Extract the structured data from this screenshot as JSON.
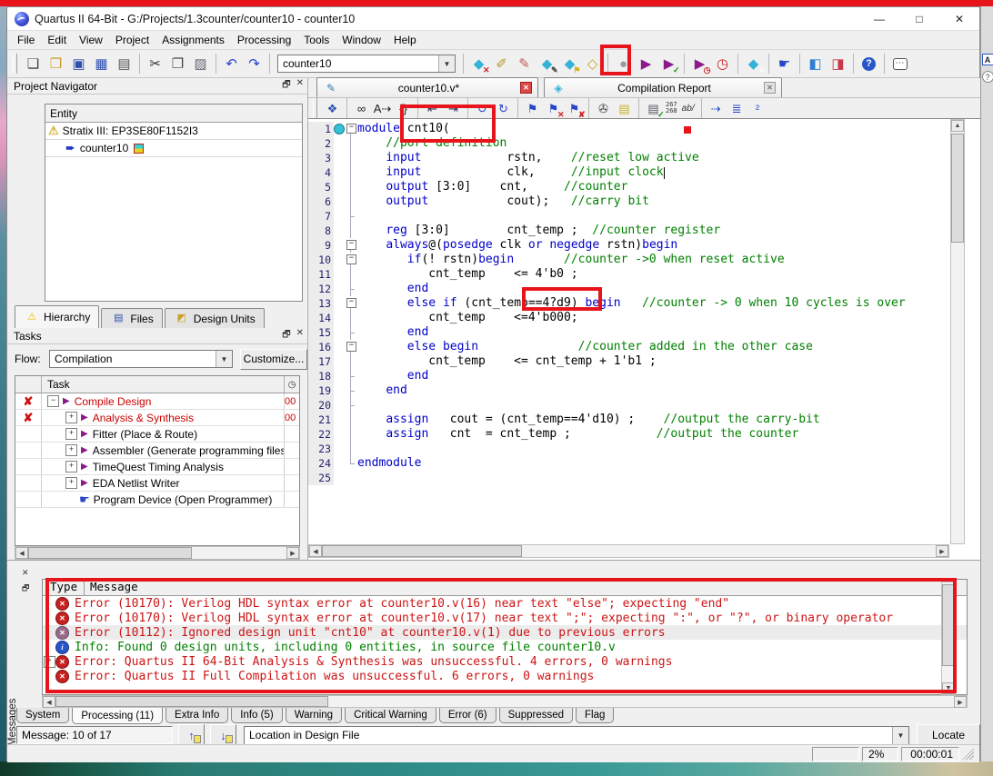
{
  "colors": {
    "annotation": "#e8141c",
    "keyword": "#0000c8",
    "comment": "#008000",
    "error_text": "#cc1414",
    "info_text": "#008000",
    "task_error": "#cc0000"
  },
  "window": {
    "title": "Quartus II 64-Bit - G:/Projects/1.3counter/counter10 - counter10",
    "controls": [
      "minimize",
      "maximize",
      "close"
    ]
  },
  "menu": {
    "items": [
      "File",
      "Edit",
      "View",
      "Project",
      "Assignments",
      "Processing",
      "Tools",
      "Window",
      "Help"
    ]
  },
  "toolbar": {
    "project_dropdown": "counter10",
    "left_groups": [
      [
        "new-file",
        "open-file",
        "save",
        "save-all",
        "print"
      ],
      [
        "cut",
        "copy",
        "paste"
      ],
      [
        "undo",
        "redo"
      ]
    ],
    "right_groups": [
      [
        "x-diamond",
        "wand-pencil",
        "pencil",
        "diamond-pencil",
        "diamond-flag",
        "diamond-xor"
      ],
      [
        "stop",
        "start-compilation",
        "start-analysis"
      ],
      [
        "run-timing",
        "timequest"
      ],
      [
        "report"
      ],
      [
        "programmer-hand"
      ],
      [
        "device-blue",
        "device-red"
      ],
      [
        "help"
      ],
      [
        "feedback"
      ]
    ]
  },
  "navigator": {
    "title": "Project Navigator",
    "entity_header": "Entity",
    "device": {
      "label": "Stratix III: EP3SE80F1152I3"
    },
    "module": {
      "label": "counter10"
    },
    "tabs": [
      {
        "label": "Hierarchy",
        "icon": "hierarchy-warning",
        "active": true
      },
      {
        "label": "Files",
        "icon": "files"
      },
      {
        "label": "Design Units",
        "icon": "design-units"
      }
    ]
  },
  "tasks": {
    "title": "Tasks",
    "flow_label": "Flow:",
    "flow_value": "Compilation",
    "customize_label": "Customize...",
    "col_task": "Task",
    "rows": [
      {
        "status": "error",
        "expand": "minus",
        "depth": 0,
        "icon": "play",
        "label": "Compile Design",
        "error": true,
        "time": "00"
      },
      {
        "status": "error",
        "expand": "plus",
        "depth": 1,
        "icon": "play",
        "label": "Analysis & Synthesis",
        "error": true,
        "time": "00"
      },
      {
        "expand": "plus",
        "depth": 1,
        "icon": "play",
        "label": "Fitter (Place & Route)"
      },
      {
        "expand": "plus",
        "depth": 1,
        "icon": "play",
        "label": "Assembler (Generate programming files)"
      },
      {
        "expand": "plus",
        "depth": 1,
        "icon": "play",
        "label": "TimeQuest Timing Analysis"
      },
      {
        "expand": "plus",
        "depth": 1,
        "icon": "play",
        "label": "EDA Netlist Writer"
      },
      {
        "depth": 1,
        "icon": "hand",
        "label": "Program Device (Open Programmer)"
      }
    ]
  },
  "editor": {
    "tabs": [
      {
        "label": "counter10.v*",
        "icon": "text-editor",
        "close": "red"
      },
      {
        "label": "Compilation Report",
        "icon": "report-diamond",
        "close": "gray"
      }
    ],
    "toolbar_icons": [
      "open-in-main",
      "|",
      "find",
      "replace",
      "brace",
      "|",
      "outdent",
      "indent",
      "|",
      "prev-loc",
      "next-loc",
      "|",
      "bookmark",
      "bookmark-x",
      "bookmark-clear",
      "|",
      "attach",
      "template",
      "|",
      "syntax-check"
    ],
    "toolbar_counts": {
      "line_top": "267",
      "line_bottom": "268",
      "ab": "ab/"
    },
    "toolbar_end_icons": [
      "goto",
      "align",
      "sup2"
    ],
    "lines": [
      {
        "n": 1,
        "fold": "box",
        "mark": true,
        "seg": [
          [
            "kw",
            "module"
          ],
          [
            "pl",
            " cnt10("
          ]
        ]
      },
      {
        "n": 2,
        "fold": "line",
        "seg": [
          [
            "cm",
            "    //port definition"
          ]
        ]
      },
      {
        "n": 3,
        "fold": "line",
        "seg": [
          [
            "pl",
            "    "
          ],
          [
            "kw",
            "input"
          ],
          [
            "pl",
            "            rstn,    "
          ],
          [
            "cm",
            "//reset low active"
          ]
        ]
      },
      {
        "n": 4,
        "fold": "line",
        "caret": true,
        "seg": [
          [
            "pl",
            "    "
          ],
          [
            "kw",
            "input"
          ],
          [
            "pl",
            "            clk,     "
          ],
          [
            "cm",
            "//input clock"
          ]
        ]
      },
      {
        "n": 5,
        "fold": "line",
        "seg": [
          [
            "pl",
            "    "
          ],
          [
            "kw",
            "output"
          ],
          [
            "pl",
            " [3:0]    cnt,     "
          ],
          [
            "cm",
            "//counter"
          ]
        ]
      },
      {
        "n": 6,
        "fold": "line",
        "seg": [
          [
            "pl",
            "    "
          ],
          [
            "kw",
            "output"
          ],
          [
            "pl",
            "           cout);   "
          ],
          [
            "cm",
            "//carry bit"
          ]
        ]
      },
      {
        "n": 7,
        "fold": "tick",
        "seg": []
      },
      {
        "n": 8,
        "fold": "line",
        "seg": [
          [
            "pl",
            "    "
          ],
          [
            "kw",
            "reg"
          ],
          [
            "pl",
            " [3:0]        cnt_temp ;  "
          ],
          [
            "cm",
            "//counter register"
          ]
        ]
      },
      {
        "n": 9,
        "fold": "box",
        "seg": [
          [
            "pl",
            "    "
          ],
          [
            "kw",
            "always"
          ],
          [
            "pl",
            "@("
          ],
          [
            "kw",
            "posedge"
          ],
          [
            "pl",
            " clk "
          ],
          [
            "kw",
            "or"
          ],
          [
            "pl",
            " "
          ],
          [
            "kw",
            "negedge"
          ],
          [
            "pl",
            " rstn)"
          ],
          [
            "kw",
            "begin"
          ]
        ]
      },
      {
        "n": 10,
        "fold": "box",
        "seg": [
          [
            "pl",
            "       "
          ],
          [
            "kw",
            "if"
          ],
          [
            "pl",
            "(! rstn)"
          ],
          [
            "kw",
            "begin"
          ],
          [
            "pl",
            "       "
          ],
          [
            "cm",
            "//counter ->0 when reset active"
          ]
        ]
      },
      {
        "n": 11,
        "fold": "line",
        "seg": [
          [
            "pl",
            "          cnt_temp    <= 4'b0 ;"
          ]
        ]
      },
      {
        "n": 12,
        "fold": "tick",
        "seg": [
          [
            "pl",
            "       "
          ],
          [
            "kw",
            "end"
          ]
        ]
      },
      {
        "n": 13,
        "fold": "box",
        "seg": [
          [
            "pl",
            "       "
          ],
          [
            "kw",
            "else"
          ],
          [
            "pl",
            " "
          ],
          [
            "kw",
            "if"
          ],
          [
            "pl",
            " (cnt_temp==4?d9) "
          ],
          [
            "kw",
            "begin"
          ],
          [
            "pl",
            "   "
          ],
          [
            "cm",
            "//counter -> 0 when 10 cycles is over"
          ]
        ]
      },
      {
        "n": 14,
        "fold": "line",
        "seg": [
          [
            "pl",
            "          cnt_temp    <=4'b000;"
          ]
        ]
      },
      {
        "n": 15,
        "fold": "tick",
        "seg": [
          [
            "pl",
            "       "
          ],
          [
            "kw",
            "end"
          ]
        ]
      },
      {
        "n": 16,
        "fold": "box",
        "seg": [
          [
            "pl",
            "       "
          ],
          [
            "kw",
            "else"
          ],
          [
            "pl",
            " "
          ],
          [
            "kw",
            "begin"
          ],
          [
            "pl",
            "              "
          ],
          [
            "cm",
            "//counter added in the other case"
          ]
        ]
      },
      {
        "n": 17,
        "fold": "line",
        "seg": [
          [
            "pl",
            "          cnt_temp    <= cnt_temp + 1'b1 ;"
          ]
        ]
      },
      {
        "n": 18,
        "fold": "tick",
        "seg": [
          [
            "pl",
            "       "
          ],
          [
            "kw",
            "end"
          ]
        ]
      },
      {
        "n": 19,
        "fold": "tick",
        "seg": [
          [
            "pl",
            "    "
          ],
          [
            "kw",
            "end"
          ]
        ]
      },
      {
        "n": 20,
        "fold": "tick",
        "seg": []
      },
      {
        "n": 21,
        "fold": "line",
        "seg": [
          [
            "pl",
            "    "
          ],
          [
            "kw",
            "assign"
          ],
          [
            "pl",
            "   cout = (cnt_temp==4'd10) ;    "
          ],
          [
            "cm",
            "//output the carry-bit"
          ]
        ]
      },
      {
        "n": 22,
        "fold": "line",
        "seg": [
          [
            "pl",
            "    "
          ],
          [
            "kw",
            "assign"
          ],
          [
            "pl",
            "   cnt  = cnt_temp ;            "
          ],
          [
            "cm",
            "//output the counter"
          ]
        ]
      },
      {
        "n": 23,
        "fold": "line",
        "seg": []
      },
      {
        "n": 24,
        "fold": "end",
        "seg": [
          [
            "kw",
            "endmodule"
          ]
        ]
      },
      {
        "n": 25,
        "fold": "none",
        "seg": []
      }
    ]
  },
  "messages": {
    "panel_label": "Messages",
    "col_type": "Type",
    "col_message": "Message",
    "rows": [
      {
        "icon": "error",
        "text": "Error (10170): Verilog HDL syntax error at counter10.v(16) near text \"else\";  expecting \"end\""
      },
      {
        "icon": "error",
        "text": "Error (10170): Verilog HDL syntax error at counter10.v(17) near text \";\";  expecting \":\", or \"?\", or binary operator"
      },
      {
        "icon": "error-dim",
        "selected": true,
        "text": "Error (10112): Ignored design unit \"cnt10\" at counter10.v(1) due to previous errors"
      },
      {
        "icon": "info",
        "text": "Info: Found 0 design units, including 0 entities, in source file counter10.v"
      },
      {
        "icon": "error",
        "expand": true,
        "text": "Error: Quartus II 64-Bit Analysis & Synthesis was unsuccessful. 4 errors, 0 warnings"
      },
      {
        "icon": "error",
        "text": "Error: Quartus II Full Compilation was unsuccessful. 6 errors, 0 warnings"
      }
    ],
    "tabs": [
      {
        "label": "System"
      },
      {
        "label": "Processing (11)",
        "active": true
      },
      {
        "label": "Extra Info"
      },
      {
        "label": "Info (5)"
      },
      {
        "label": "Warning"
      },
      {
        "label": "Critical Warning"
      },
      {
        "label": "Error (6)"
      },
      {
        "label": "Suppressed"
      },
      {
        "label": "Flag"
      }
    ],
    "counter": "Message: 10 of 17",
    "location_value": "Location in Design File",
    "locate_label": "Locate"
  },
  "statusbar": {
    "progress": "2%",
    "elapsed": "00:00:01"
  }
}
